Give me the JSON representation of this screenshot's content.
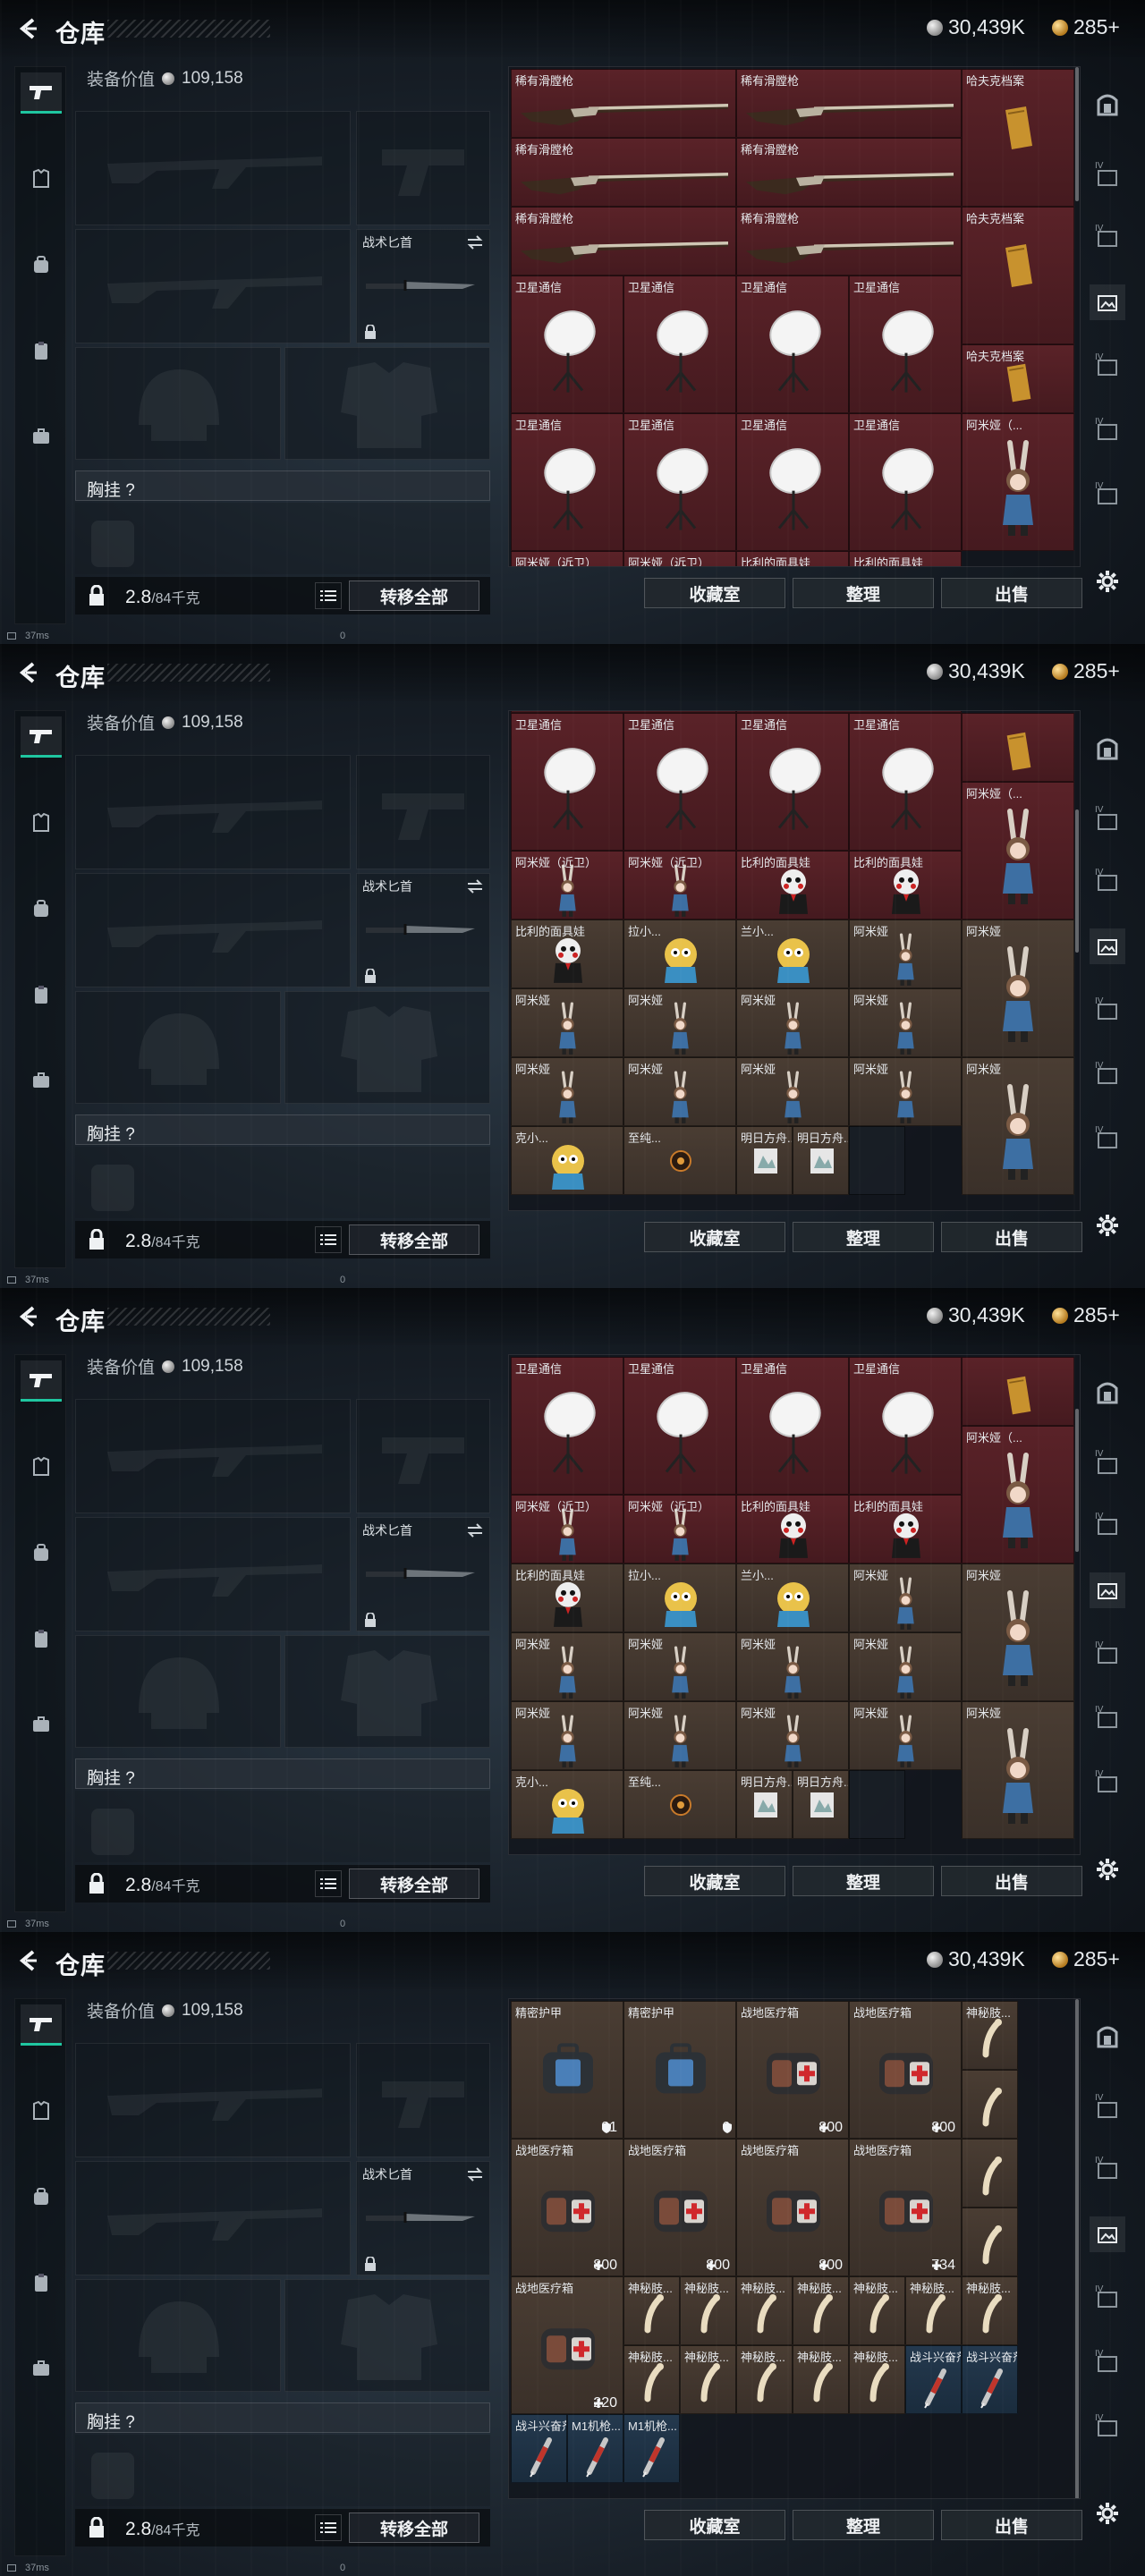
{
  "header": {
    "title": "仓库",
    "silver": "30,439K",
    "gold": "285+"
  },
  "equipment": {
    "value_label": "装备价值",
    "value": "109,158",
    "knife_label": "战术匕首",
    "chest_label": "胸挂 ?"
  },
  "footer": {
    "weight_value": "2.8",
    "weight_capacity": "/84千克",
    "transfer_all": "转移全部"
  },
  "actions": {
    "collection": "收藏室",
    "organize": "整理",
    "sell": "出售"
  },
  "statusbar": {
    "ping": "37ms",
    "zero": "0"
  },
  "rail_tag": "IV",
  "icons": [
    "pistol-icon",
    "armor-icon",
    "backpack-icon",
    "clipboard-icon",
    "briefcase-icon",
    "safe-icon",
    "photo-icon",
    "gear-icon",
    "back-icon",
    "lock-icon",
    "swap-icon",
    "list-icon"
  ],
  "colors": {
    "accent": "#1fc6a0",
    "red_rarity": "#5a2228",
    "brown_rarity": "#4a3d33",
    "blue_rarity": "#24394e"
  },
  "frames": [
    {
      "cells": [
        {
          "label": "稀有滑膛枪",
          "art": "musket",
          "rarity": "red"
        },
        {
          "label": "稀有滑膛枪",
          "art": "musket",
          "rarity": "red"
        },
        {
          "label": "哈夫克档案",
          "art": "folder",
          "rarity": "red"
        },
        {
          "label": "稀有滑膛枪",
          "art": "musket",
          "rarity": "red"
        },
        {
          "label": "稀有滑膛枪",
          "art": "musket",
          "rarity": "red"
        },
        {
          "label": "稀有滑膛枪",
          "art": "musket",
          "rarity": "red"
        },
        {
          "label": "稀有滑膛枪",
          "art": "musket",
          "rarity": "red"
        },
        {
          "label": "哈夫克档案",
          "art": "folder",
          "rarity": "red"
        },
        {
          "label": "卫星通信",
          "art": "dish",
          "rarity": "red"
        },
        {
          "label": "卫星通信",
          "art": "dish",
          "rarity": "red"
        },
        {
          "label": "卫星通信",
          "art": "dish",
          "rarity": "red"
        },
        {
          "label": "卫星通信",
          "art": "dish",
          "rarity": "red"
        },
        {
          "label": "哈夫克档案",
          "art": "folder",
          "rarity": "red"
        },
        {
          "label": "卫星通信",
          "art": "dish",
          "rarity": "red"
        },
        {
          "label": "卫星通信",
          "art": "dish",
          "rarity": "red"
        },
        {
          "label": "卫星通信",
          "art": "dish",
          "rarity": "red"
        },
        {
          "label": "卫星通信",
          "art": "dish",
          "rarity": "red"
        },
        {
          "label": "阿米娅（...",
          "art": "bunny",
          "rarity": "red"
        },
        {
          "label": "阿米娅（近卫）",
          "art": "bunny",
          "rarity": "red"
        },
        {
          "label": "阿米娅（近卫）",
          "art": "bunny",
          "rarity": "red"
        },
        {
          "label": "比利的面具娃",
          "art": "doll",
          "rarity": "red"
        },
        {
          "label": "比利的面具娃",
          "art": "doll",
          "rarity": "red"
        }
      ]
    },
    {
      "cells": [
        {
          "label": "",
          "art": "blank",
          "rarity": "red"
        },
        {
          "label": "",
          "art": "blank",
          "rarity": "red"
        },
        {
          "label": "",
          "art": "folder",
          "rarity": "red"
        },
        {
          "label": "卫星通信",
          "art": "dish",
          "rarity": "red"
        },
        {
          "label": "卫星通信",
          "art": "dish",
          "rarity": "red"
        },
        {
          "label": "卫星通信",
          "art": "dish",
          "rarity": "red"
        },
        {
          "label": "卫星通信",
          "art": "dish",
          "rarity": "red"
        },
        {
          "label": "阿米娅（...",
          "art": "bunny",
          "rarity": "red"
        },
        {
          "label": "阿米娅（近卫）",
          "art": "bunny",
          "rarity": "red"
        },
        {
          "label": "阿米娅（近卫）",
          "art": "bunny",
          "rarity": "red"
        },
        {
          "label": "比利的面具娃",
          "art": "doll",
          "rarity": "red"
        },
        {
          "label": "比利的面具娃",
          "art": "doll",
          "rarity": "red"
        },
        {
          "label": "比利的面具娃",
          "art": "doll",
          "rarity": "brown"
        },
        {
          "label": "拉小...",
          "art": "mascot",
          "rarity": "brown"
        },
        {
          "label": "兰小...",
          "art": "mascot",
          "rarity": "brown"
        },
        {
          "label": "阿米娅",
          "art": "bunny",
          "rarity": "brown"
        },
        {
          "label": "阿米娅",
          "art": "bunny",
          "rarity": "brown"
        },
        {
          "label": "阿米娅",
          "art": "bunny",
          "rarity": "brown"
        },
        {
          "label": "阿米娅",
          "art": "bunny",
          "rarity": "brown"
        },
        {
          "label": "阿米娅",
          "art": "bunny",
          "rarity": "brown"
        },
        {
          "label": "阿米娅",
          "art": "bunny",
          "rarity": "brown"
        },
        {
          "label": "阿米娅",
          "art": "bunny",
          "rarity": "brown"
        },
        {
          "label": "阿米娅",
          "art": "bunny",
          "rarity": "brown"
        },
        {
          "label": "阿米娅",
          "art": "bunny",
          "rarity": "brown"
        },
        {
          "label": "阿米娅",
          "art": "bunny",
          "rarity": "brown"
        },
        {
          "label": "阿米娅",
          "art": "bunny",
          "rarity": "brown"
        },
        {
          "label": "克小...",
          "art": "mascot",
          "rarity": "brown"
        },
        {
          "label": "至纯...",
          "art": "gem",
          "rarity": "brown"
        },
        {
          "label": "明日方舟...",
          "art": "card",
          "rarity": "brown"
        },
        {
          "label": "明日方舟...",
          "art": "card",
          "rarity": "brown"
        },
        {
          "label": "",
          "art": "blank",
          "rarity": "empty"
        }
      ]
    },
    {
      "cells": [
        {
          "label": "卫星通信",
          "art": "dish",
          "rarity": "red"
        },
        {
          "label": "卫星通信",
          "art": "dish",
          "rarity": "red"
        },
        {
          "label": "卫星通信",
          "art": "dish",
          "rarity": "red"
        },
        {
          "label": "卫星通信",
          "art": "dish",
          "rarity": "red"
        },
        {
          "label": "",
          "art": "folder",
          "rarity": "red"
        },
        {
          "label": "阿米娅（...",
          "art": "bunny",
          "rarity": "red"
        },
        {
          "label": "阿米娅（近卫）",
          "art": "bunny",
          "rarity": "red"
        },
        {
          "label": "阿米娅（近卫）",
          "art": "bunny",
          "rarity": "red"
        },
        {
          "label": "比利的面具娃",
          "art": "doll",
          "rarity": "red"
        },
        {
          "label": "比利的面具娃",
          "art": "doll",
          "rarity": "red"
        },
        {
          "label": "比利的面具娃",
          "art": "doll",
          "rarity": "brown"
        },
        {
          "label": "拉小...",
          "art": "mascot",
          "rarity": "brown"
        },
        {
          "label": "兰小...",
          "art": "mascot",
          "rarity": "brown"
        },
        {
          "label": "阿米娅",
          "art": "bunny",
          "rarity": "brown"
        },
        {
          "label": "阿米娅",
          "art": "bunny",
          "rarity": "brown"
        },
        {
          "label": "阿米娅",
          "art": "bunny",
          "rarity": "brown"
        },
        {
          "label": "阿米娅",
          "art": "bunny",
          "rarity": "brown"
        },
        {
          "label": "阿米娅",
          "art": "bunny",
          "rarity": "brown"
        },
        {
          "label": "阿米娅",
          "art": "bunny",
          "rarity": "brown"
        },
        {
          "label": "阿米娅",
          "art": "bunny",
          "rarity": "brown"
        },
        {
          "label": "阿米娅",
          "art": "bunny",
          "rarity": "brown"
        },
        {
          "label": "阿米娅",
          "art": "bunny",
          "rarity": "brown"
        },
        {
          "label": "阿米娅",
          "art": "bunny",
          "rarity": "brown"
        },
        {
          "label": "阿米娅",
          "art": "bunny",
          "rarity": "brown"
        },
        {
          "label": "克小...",
          "art": "mascot",
          "rarity": "brown"
        },
        {
          "label": "至纯...",
          "art": "gem",
          "rarity": "brown"
        },
        {
          "label": "明日方舟...",
          "art": "card",
          "rarity": "brown"
        },
        {
          "label": "明日方舟...",
          "art": "card",
          "rarity": "brown"
        },
        {
          "label": "",
          "art": "blank",
          "rarity": "empty"
        }
      ]
    },
    {
      "cells": [
        {
          "label": "精密护甲",
          "art": "armor",
          "rarity": "brown",
          "stat": "81"
        },
        {
          "label": "精密护甲",
          "art": "armor",
          "rarity": "brown",
          "stat": "6"
        },
        {
          "label": "战地医疗箱",
          "art": "medkit",
          "rarity": "brown",
          "stat": "800"
        },
        {
          "label": "战地医疗箱",
          "art": "medkit",
          "rarity": "brown",
          "stat": "800"
        },
        {
          "label": "神秘肢...",
          "art": "bone",
          "rarity": "brown"
        },
        {
          "label": "",
          "art": "bone",
          "rarity": "brown"
        },
        {
          "label": "战地医疗箱",
          "art": "medkit",
          "rarity": "brown",
          "stat": "800"
        },
        {
          "label": "战地医疗箱",
          "art": "medkit",
          "rarity": "brown",
          "stat": "800"
        },
        {
          "label": "战地医疗箱",
          "art": "medkit",
          "rarity": "brown",
          "stat": "800"
        },
        {
          "label": "战地医疗箱",
          "art": "medkit",
          "rarity": "brown",
          "stat": "734"
        },
        {
          "label": "",
          "art": "bone",
          "rarity": "brown"
        },
        {
          "label": "",
          "art": "bone",
          "rarity": "brown"
        },
        {
          "label": "战地医疗箱",
          "art": "medkit",
          "rarity": "brown",
          "stat": "220"
        },
        {
          "label": "神秘肢...",
          "art": "bone",
          "rarity": "brown"
        },
        {
          "label": "神秘肢...",
          "art": "bone",
          "rarity": "brown"
        },
        {
          "label": "神秘肢...",
          "art": "bone",
          "rarity": "brown"
        },
        {
          "label": "神秘肢...",
          "art": "bone",
          "rarity": "brown"
        },
        {
          "label": "神秘肢...",
          "art": "bone",
          "rarity": "brown"
        },
        {
          "label": "神秘肢...",
          "art": "bone",
          "rarity": "brown"
        },
        {
          "label": "神秘肢...",
          "art": "bone",
          "rarity": "brown"
        },
        {
          "label": "神秘肢...",
          "art": "bone",
          "rarity": "brown"
        },
        {
          "label": "神秘肢...",
          "art": "bone",
          "rarity": "brown"
        },
        {
          "label": "神秘肢...",
          "art": "bone",
          "rarity": "brown"
        },
        {
          "label": "神秘肢...",
          "art": "bone",
          "rarity": "brown"
        },
        {
          "label": "神秘肢...",
          "art": "bone",
          "rarity": "brown"
        },
        {
          "label": "战斗兴奋剂",
          "art": "syringe",
          "rarity": "blue"
        },
        {
          "label": "战斗兴奋剂",
          "art": "syringe",
          "rarity": "blue"
        },
        {
          "label": "战斗兴奋剂",
          "art": "syringe",
          "rarity": "blue"
        },
        {
          "label": "M1机枪...",
          "art": "syringe",
          "rarity": "blue"
        },
        {
          "label": "M1机枪...",
          "art": "syringe",
          "rarity": "blue"
        }
      ]
    }
  ]
}
